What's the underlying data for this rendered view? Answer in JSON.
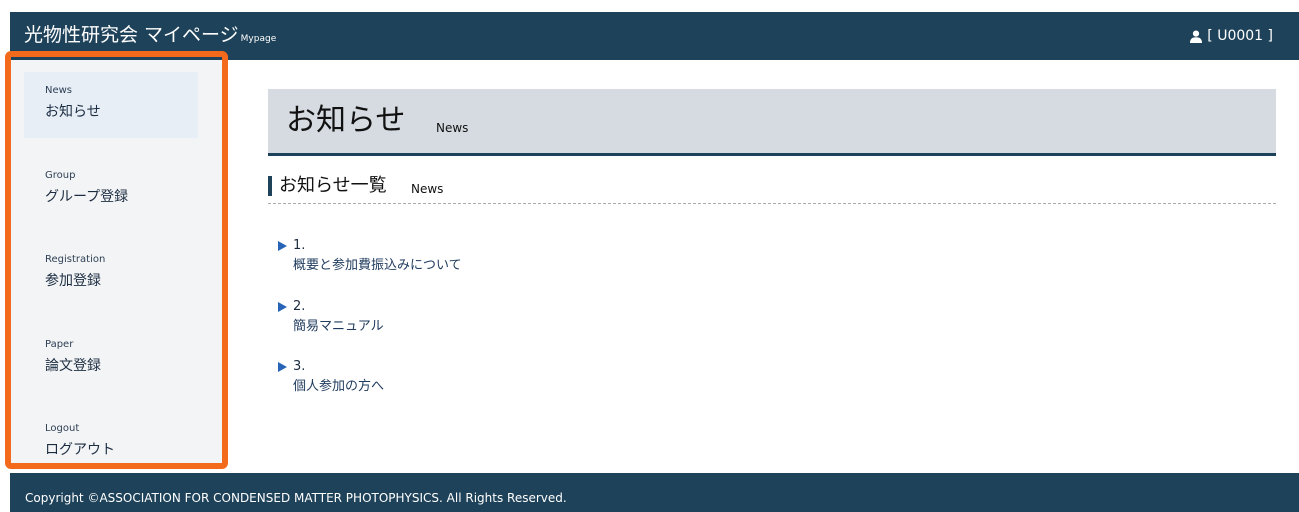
{
  "header": {
    "title": "光物性研究会 マイページ",
    "title_sub": "Mypage",
    "user_label": "[  U0001  ]"
  },
  "sidebar": {
    "items": [
      {
        "en": "News",
        "ja": "お知らせ",
        "active": true
      },
      {
        "en": "Group",
        "ja": "グループ登録"
      },
      {
        "en": "Registration",
        "ja": "参加登録"
      },
      {
        "en": "Paper",
        "ja": "論文登録"
      },
      {
        "en": "Logout",
        "ja": "ログアウト"
      }
    ]
  },
  "main": {
    "page_title": "お知らせ",
    "page_title_sub": "News",
    "section_title": "お知らせ一覧",
    "section_sub": "News",
    "news": [
      {
        "num": "1.",
        "title": "概要と参加費振込みについて"
      },
      {
        "num": "2.",
        "title": "簡易マニュアル"
      },
      {
        "num": "3.",
        "title": "個人参加の方へ"
      }
    ]
  },
  "footer": {
    "copyright": "Copyright ©ASSOCIATION FOR CONDENSED MATTER PHOTOPHYSICS. All Rights Reserved."
  },
  "colors": {
    "header_bg": "#1e4259",
    "highlight": "#f46a1c",
    "link": "#1e3a5c",
    "arrow": "#2764b8"
  }
}
